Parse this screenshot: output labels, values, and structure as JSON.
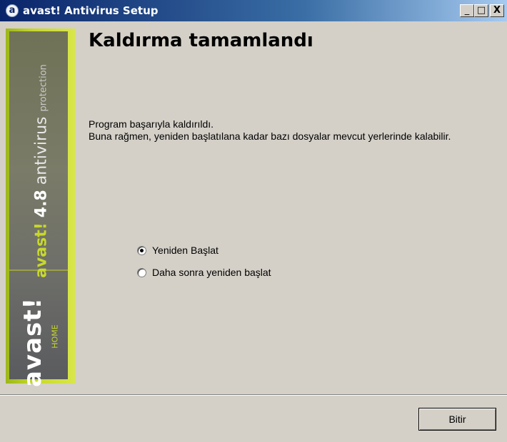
{
  "window": {
    "title": "avast! Antivirus Setup",
    "icon_letter": "a",
    "controls": {
      "minimize": "_",
      "maximize": "□",
      "close": "X"
    }
  },
  "banner": {
    "brand": "avast!",
    "version": "4.8",
    "product": "antivirus",
    "product_sub": "protection",
    "logo": "avast!",
    "edition": "HOME"
  },
  "main": {
    "title": "Kaldırma tamamlandı",
    "message_line1": "Program başarıyla kaldırıldı.",
    "message_line2": "Buna rağmen, yeniden başlatılana kadar bazı dosyalar mevcut yerlerinde kalabilir.",
    "options": [
      {
        "label": "Yeniden Başlat",
        "selected": true
      },
      {
        "label": "Daha sonra yeniden başlat",
        "selected": false
      }
    ]
  },
  "footer": {
    "finish_label": "Bitir"
  },
  "colors": {
    "titlebar": "#0a246a",
    "banner_accent": "#c8d82b",
    "dialog_bg": "#d4d0c8"
  }
}
